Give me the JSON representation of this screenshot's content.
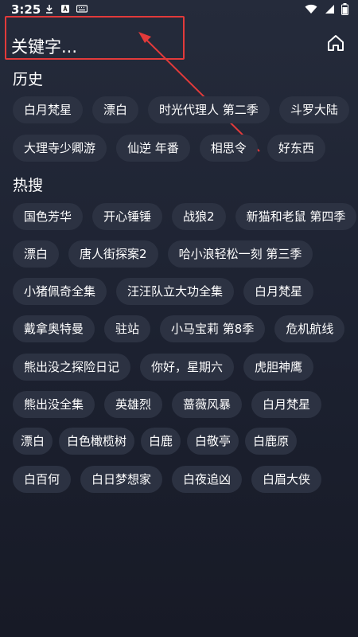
{
  "status": {
    "time": "3:25"
  },
  "search": {
    "placeholder": "关键字..."
  },
  "sections": {
    "history_title": "历史",
    "hot_title": "热搜"
  },
  "history": [
    [
      "白月梵星",
      "漂白",
      "时光代理人 第二季",
      "斗罗大陆"
    ],
    [
      "大理寺少卿游",
      "仙逆 年番",
      "相思令",
      "好东西"
    ]
  ],
  "hot": [
    [
      "国色芳华",
      "开心锤锤",
      "战狼2",
      "新猫和老鼠 第四季"
    ],
    [
      "漂白",
      "唐人街探案2",
      "哈小浪轻松一刻 第三季"
    ],
    [
      "小猪佩奇全集",
      "汪汪队立大功全集",
      "白月梵星"
    ],
    [
      "戴拿奥特曼",
      "驻站",
      "小马宝莉 第8季",
      "危机航线"
    ],
    [
      "熊出没之探险日记",
      "你好，星期六",
      "虎胆神鹰"
    ],
    [
      "熊出没全集",
      "英雄烈",
      "蔷薇风暴",
      "白月梵星"
    ],
    [
      "漂白",
      "白色橄榄树",
      "白鹿",
      "白敬亭",
      "白鹿原"
    ],
    [
      "白百何",
      "白日梦想家",
      "白夜追凶",
      "白眉大侠"
    ]
  ],
  "colors": {
    "annotation": "#e23a3a",
    "chip": "#2c3242"
  }
}
